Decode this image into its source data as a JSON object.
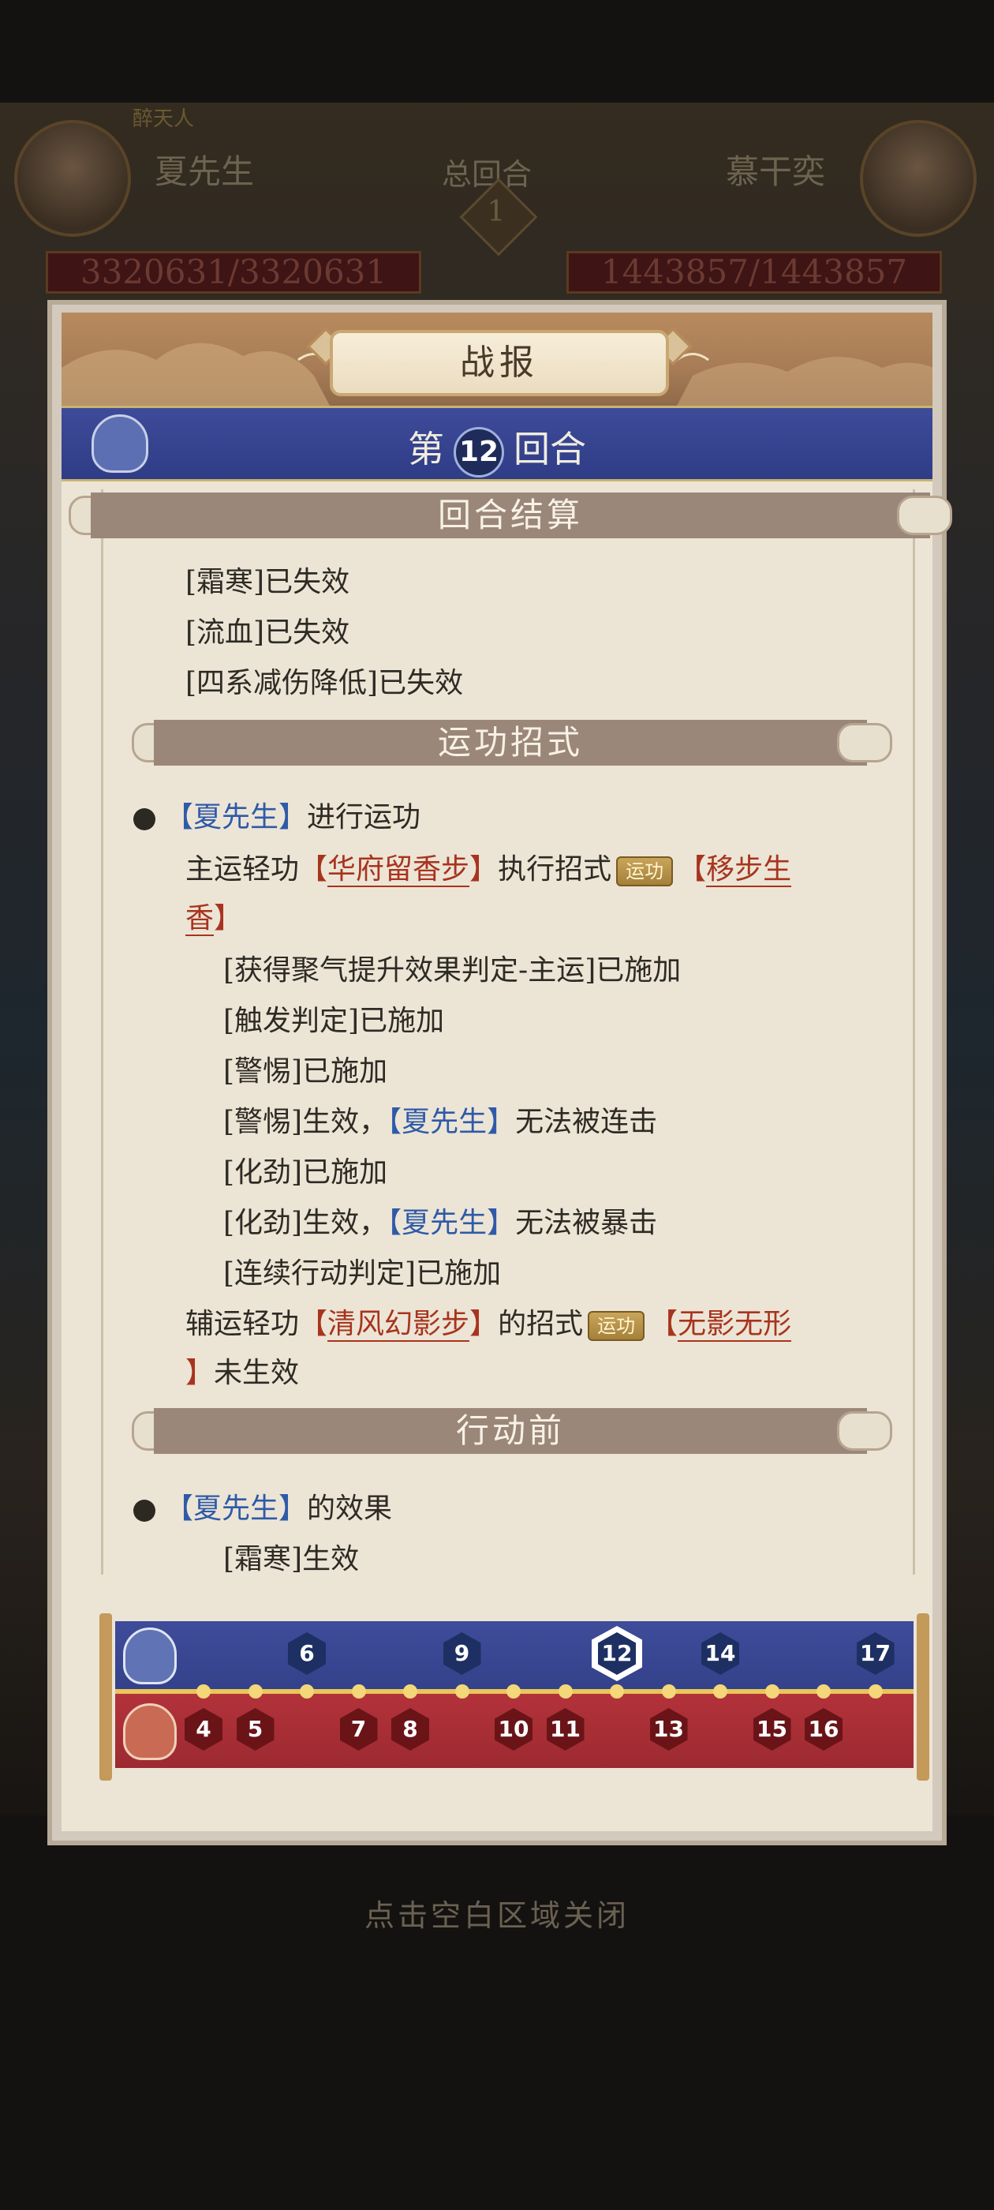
{
  "hud": {
    "left_name": "夏先生",
    "left_tag": "醉天人",
    "left_hp": "3320631/3320631",
    "center_label": "总回合",
    "center_round": "1",
    "right_name": "慕干奕",
    "right_hp": "1443857/1443857"
  },
  "panel": {
    "title": "战报",
    "round_prefix": "第",
    "round_number": "12",
    "round_suffix": "回合"
  },
  "sections": {
    "settlement": {
      "heading": "回合结算",
      "lines": [
        "[霜寒]已失效",
        "[流血]已失效",
        "[四系减伤降低]已失效"
      ]
    },
    "skill": {
      "heading": "运功招式",
      "actor": "夏先生",
      "actor_open": "【",
      "actor_close": "】",
      "action": "进行运功",
      "main_prefix": "主运轻功",
      "main_skill": "华府留香步",
      "main_mid": "执行招式",
      "badge": "运功",
      "main_move_a": "移步生",
      "main_move_b": "香",
      "effects": [
        "[获得聚气提升效果判定-主运]已施加",
        "[触发判定]已施加",
        "[警惕]已施加"
      ],
      "alert_effect_prefix": "[警惕]生效，",
      "alert_effect_suffix": "无法被连击",
      "huajin_applied": "[化劲]已施加",
      "huajin_effect_prefix": "[化劲]生效，",
      "huajin_effect_suffix": "无法被暴击",
      "chain_applied": "[连续行动判定]已施加",
      "aux_prefix": "辅运轻功",
      "aux_skill": "清风幻影步",
      "aux_mid": "的招式",
      "aux_move": "无影无形",
      "aux_suffix": "未生效"
    },
    "before_action": {
      "heading": "行动前",
      "actor": "夏先生",
      "text": "的效果",
      "line": "[霜寒]生效"
    }
  },
  "timeline": {
    "top_turns": [
      "6",
      "9",
      "12",
      "14",
      "17"
    ],
    "current_turn": "12",
    "bottom_turns": [
      "4",
      "5",
      "7",
      "8",
      "10",
      "11",
      "13",
      "15",
      "16"
    ]
  },
  "close_hint": "点击空白区域关闭",
  "colors": {
    "ally_blue": "#2f5aa8",
    "skill_red": "#a8341e",
    "round_bar": "#33418a",
    "enemy_bar": "#9d2a31"
  }
}
